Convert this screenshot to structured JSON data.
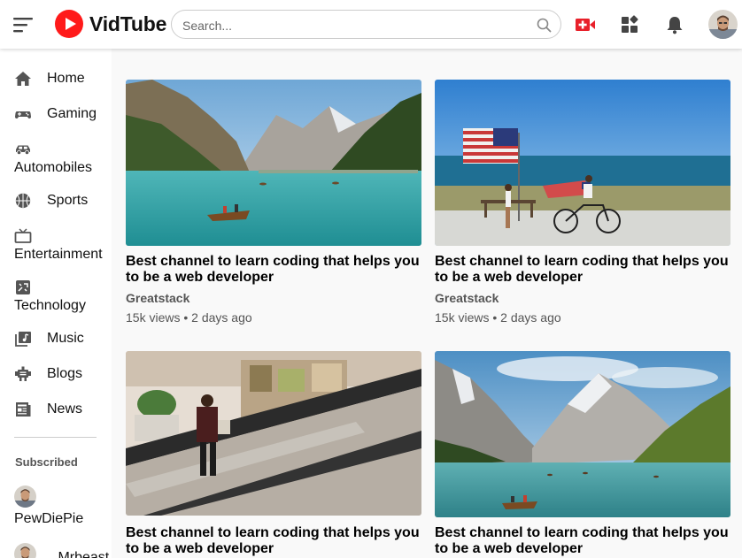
{
  "app": {
    "brand": "VidTube",
    "brand_color": "#ff0000"
  },
  "search": {
    "placeholder": "Search..."
  },
  "header_icons": [
    "menu-icon",
    "upload-icon",
    "apps-icon",
    "notification-icon",
    "user-avatar"
  ],
  "sidebar": {
    "items": [
      {
        "label": "Home",
        "icon": "home-icon"
      },
      {
        "label": "Gaming",
        "icon": "gamepad-icon"
      },
      {
        "label": "Automobiles",
        "icon": "car-icon"
      },
      {
        "label": "Sports",
        "icon": "basketball-icon"
      },
      {
        "label": "Entertainment",
        "icon": "tv-icon"
      },
      {
        "label": "Technology",
        "icon": "tech-icon"
      },
      {
        "label": "Music",
        "icon": "music-icon"
      },
      {
        "label": "Blogs",
        "icon": "blog-icon"
      },
      {
        "label": "News",
        "icon": "news-icon"
      }
    ],
    "subscribed_title": "Subscribed",
    "subscribed": [
      {
        "name": "PewDiePie"
      },
      {
        "name": "Mrbeast"
      }
    ]
  },
  "videos": [
    {
      "title": "Best channel to learn coding that helps you to be a web developer",
      "channel": "Greatstack",
      "meta": "15k views • 2 days ago",
      "thumb": "mountain-lake-boat"
    },
    {
      "title": "Best channel to learn coding that helps you to be a web developer",
      "channel": "Greatstack",
      "meta": "15k views • 2 days ago",
      "thumb": "beach-flag-bike"
    },
    {
      "title": "Best channel to learn coding that helps you to be a web developer",
      "channel": "",
      "meta": "",
      "thumb": "mall-escalator"
    },
    {
      "title": "Best channel to learn coding that helps you to be a web developer",
      "channel": "",
      "meta": "",
      "thumb": "alpine-lake-boats"
    }
  ]
}
